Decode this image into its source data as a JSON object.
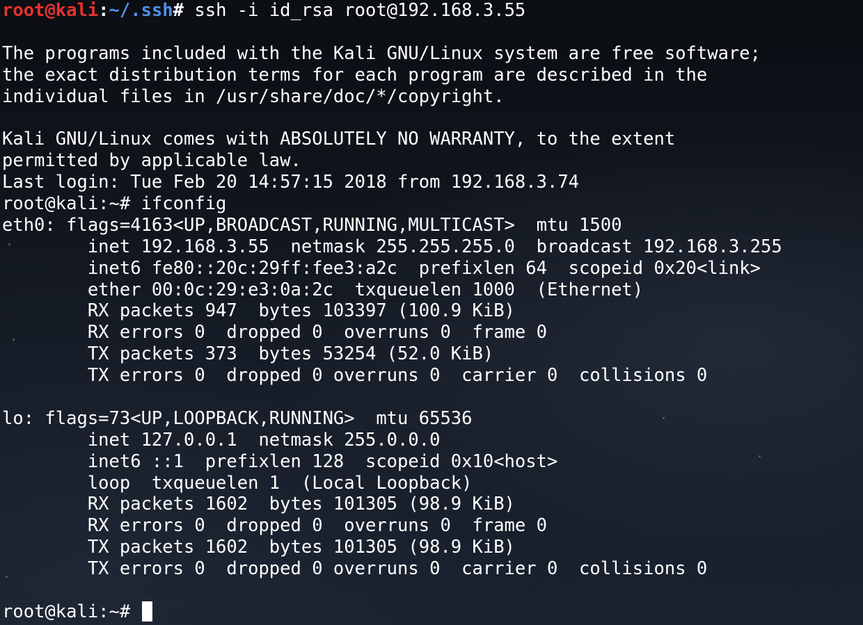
{
  "terminal": {
    "first_prompt": {
      "user_host": "root@kali",
      "sep": ":",
      "path": "~/.ssh",
      "symbol": "#",
      "command": " ssh -i id_rsa root@192.168.3.55"
    },
    "output_lines": [
      "",
      "The programs included with the Kali GNU/Linux system are free software;",
      "the exact distribution terms for each program are described in the",
      "individual files in /usr/share/doc/*/copyright.",
      "",
      "Kali GNU/Linux comes with ABSOLUTELY NO WARRANTY, to the extent",
      "permitted by applicable law.",
      "Last login: Tue Feb 20 14:57:15 2018 from 192.168.3.74",
      "root@kali:~# ifconfig",
      "eth0: flags=4163<UP,BROADCAST,RUNNING,MULTICAST>  mtu 1500",
      "        inet 192.168.3.55  netmask 255.255.255.0  broadcast 192.168.3.255",
      "        inet6 fe80::20c:29ff:fee3:a2c  prefixlen 64  scopeid 0x20<link>",
      "        ether 00:0c:29:e3:0a:2c  txqueuelen 1000  (Ethernet)",
      "        RX packets 947  bytes 103397 (100.9 KiB)",
      "        RX errors 0  dropped 0  overruns 0  frame 0",
      "        TX packets 373  bytes 53254 (52.0 KiB)",
      "        TX errors 0  dropped 0 overruns 0  carrier 0  collisions 0",
      "",
      "lo: flags=73<UP,LOOPBACK,RUNNING>  mtu 65536",
      "        inet 127.0.0.1  netmask 255.0.0.0",
      "        inet6 ::1  prefixlen 128  scopeid 0x10<host>",
      "        loop  txqueuelen 1  (Local Loopback)",
      "        RX packets 1602  bytes 101305 (98.9 KiB)",
      "        RX errors 0  dropped 0  overruns 0  frame 0",
      "        TX packets 1602  bytes 101305 (98.9 KiB)",
      "        TX errors 0  dropped 0 overruns 0  carrier 0  collisions 0",
      ""
    ],
    "final_prompt": "root@kali:~# ",
    "colors": {
      "prompt_user_host": "#e6322e",
      "prompt_path": "#4f8fe8",
      "text": "#ffffff",
      "background": "#0d1117"
    }
  }
}
